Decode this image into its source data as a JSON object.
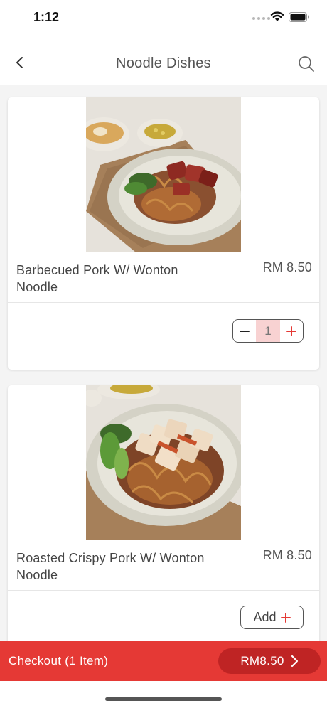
{
  "status_bar": {
    "time": "1:12",
    "icons": [
      "signal-dots-icon",
      "wifi-icon",
      "battery-icon"
    ]
  },
  "nav": {
    "title": "Noodle Dishes",
    "back_icon": "chevron-left-icon",
    "search_icon": "search-icon"
  },
  "products": [
    {
      "name": "Barbecued Pork W/ Wonton Noodle",
      "price": "RM 8.50",
      "quantity": "1",
      "image": "bbq-pork-wonton-noodle-photo"
    },
    {
      "name": "Roasted Crispy Pork W/ Wonton Noodle",
      "price": "RM 8.50",
      "add_label": "Add",
      "image": "roasted-pork-wonton-noodle-photo"
    }
  ],
  "checkout": {
    "label": "Checkout (1 Item)",
    "total": "RM8.50"
  },
  "colors": {
    "accent": "#e53935",
    "accent_dark": "#bf2424",
    "qty_highlight": "#f8d2d2"
  }
}
